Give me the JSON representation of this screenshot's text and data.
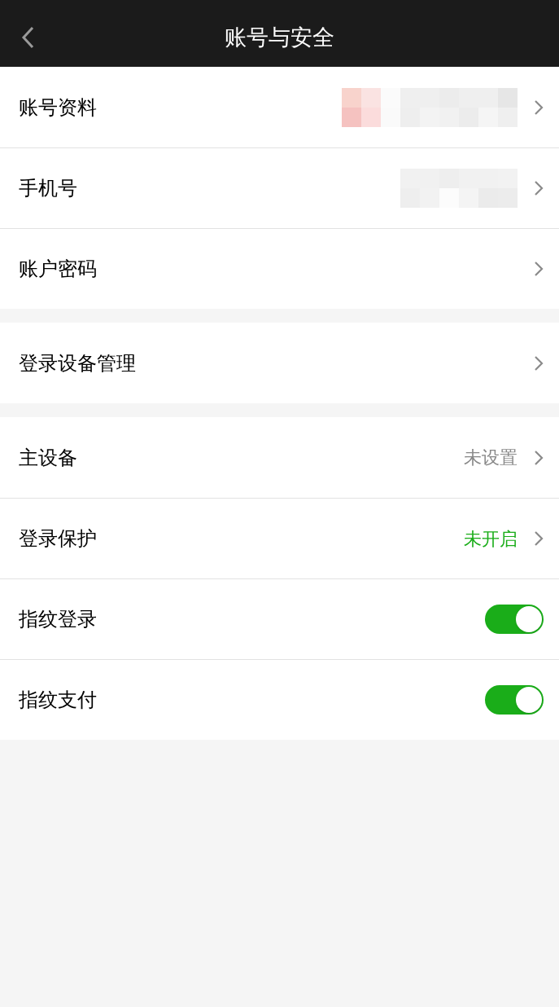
{
  "nav_bar": {
    "title": "账号与安全"
  },
  "groups": [
    {
      "items": [
        {
          "kind": "link",
          "label": "账号资料",
          "redacted": true
        },
        {
          "kind": "link",
          "label": "手机号",
          "redacted": true
        },
        {
          "kind": "link",
          "label": "账户密码"
        }
      ]
    },
    {
      "items": [
        {
          "kind": "link",
          "label": "登录设备管理"
        }
      ]
    },
    {
      "items": [
        {
          "kind": "link",
          "label": "主设备",
          "value": "未设置",
          "color": "#888888"
        },
        {
          "kind": "link",
          "label": "登录保护",
          "value": "未开启",
          "color": "#1aad19"
        },
        {
          "kind": "switch",
          "label": "指纹登录",
          "on": true
        },
        {
          "kind": "switch",
          "label": "指纹支付",
          "on": true
        }
      ]
    }
  ]
}
